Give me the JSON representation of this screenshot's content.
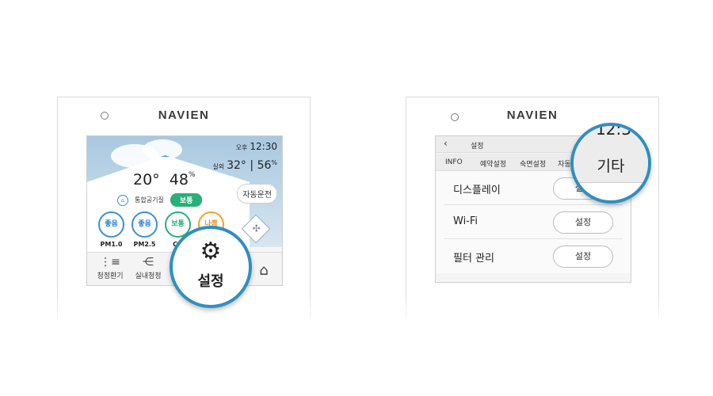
{
  "left_panel": {
    "brand": "NAVIEN",
    "time_ampm": "오후",
    "time": "12:30",
    "outdoor_label": "실외",
    "outdoor_temp": "32°",
    "outdoor_sep": "|",
    "outdoor_humidity": "56",
    "outdoor_humidity_unit": "%",
    "indoor_temp": "20°",
    "indoor_humidity": "48",
    "indoor_humidity_unit": "%",
    "air_quality_label": "통합공기질",
    "air_quality_status": "보통",
    "auto_mode_label": "자동운전",
    "sensors": [
      {
        "status": "좋음",
        "name": "PM1.0",
        "color": "blue"
      },
      {
        "status": "좋음",
        "name": "PM2.5",
        "color": "blue"
      },
      {
        "status": "보통",
        "name": "CO",
        "color": "green"
      },
      {
        "status": "나쁨",
        "name": "",
        "color": "orange"
      }
    ],
    "tabs": [
      {
        "label": "청정환기",
        "icon": "ventilation-icon"
      },
      {
        "label": "실내청정",
        "icon": "indoor-clean-icon"
      }
    ],
    "home_icon": "home-icon",
    "magnifier": {
      "icon": "gear-icon",
      "label": "설정"
    }
  },
  "right_panel": {
    "brand": "NAVIEN",
    "header_title": "설정",
    "tabs": [
      "INFO",
      "예약설정",
      "숙면설정",
      "자동"
    ],
    "rows": [
      {
        "label": "디스플레이",
        "button": "설정"
      },
      {
        "label": "Wi-Fi",
        "button": "설정"
      },
      {
        "label": "필터 관리",
        "button": "설정"
      }
    ],
    "magnifier": {
      "clock_fragment": "12:3",
      "label": "기타"
    }
  },
  "colors": {
    "accent_ring": "#2f8fc0",
    "good": "#3a8fd8",
    "normal": "#27b07a",
    "bad": "#f0a030"
  }
}
